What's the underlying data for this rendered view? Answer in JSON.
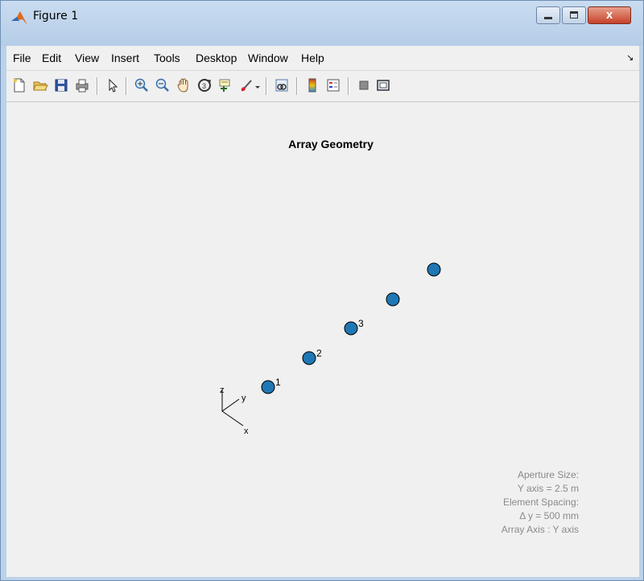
{
  "window": {
    "title": "Figure 1",
    "close_label": "x"
  },
  "menu": {
    "items": [
      "File",
      "Edit",
      "View",
      "Insert",
      "Tools",
      "Desktop",
      "Window",
      "Help"
    ],
    "overflow_glyph": "↘"
  },
  "toolbar": {
    "icons": [
      "new-figure-icon",
      "open-file-icon",
      "save-icon",
      "print-icon",
      "pointer-icon",
      "zoom-in-icon",
      "zoom-out-icon",
      "pan-icon",
      "rotate-3d-icon",
      "data-cursor-icon",
      "brush-icon",
      "link-plot-icon",
      "colorbar-icon",
      "legend-icon",
      "hide-plot-tools-icon",
      "show-plot-tools-icon"
    ]
  },
  "plot": {
    "title": "Array Geometry",
    "element_color": "#1f77b4",
    "element_labels": [
      "1",
      "2",
      "3"
    ],
    "axis_labels": {
      "x": "x",
      "y": "y",
      "z": "z"
    },
    "info": {
      "line1": "Aperture Size:",
      "line2": "Y axis = 2.5 m",
      "line3": "Element Spacing:",
      "line4": "Δ y = 500 mm",
      "line5": "Array Axis : Y axis"
    }
  }
}
